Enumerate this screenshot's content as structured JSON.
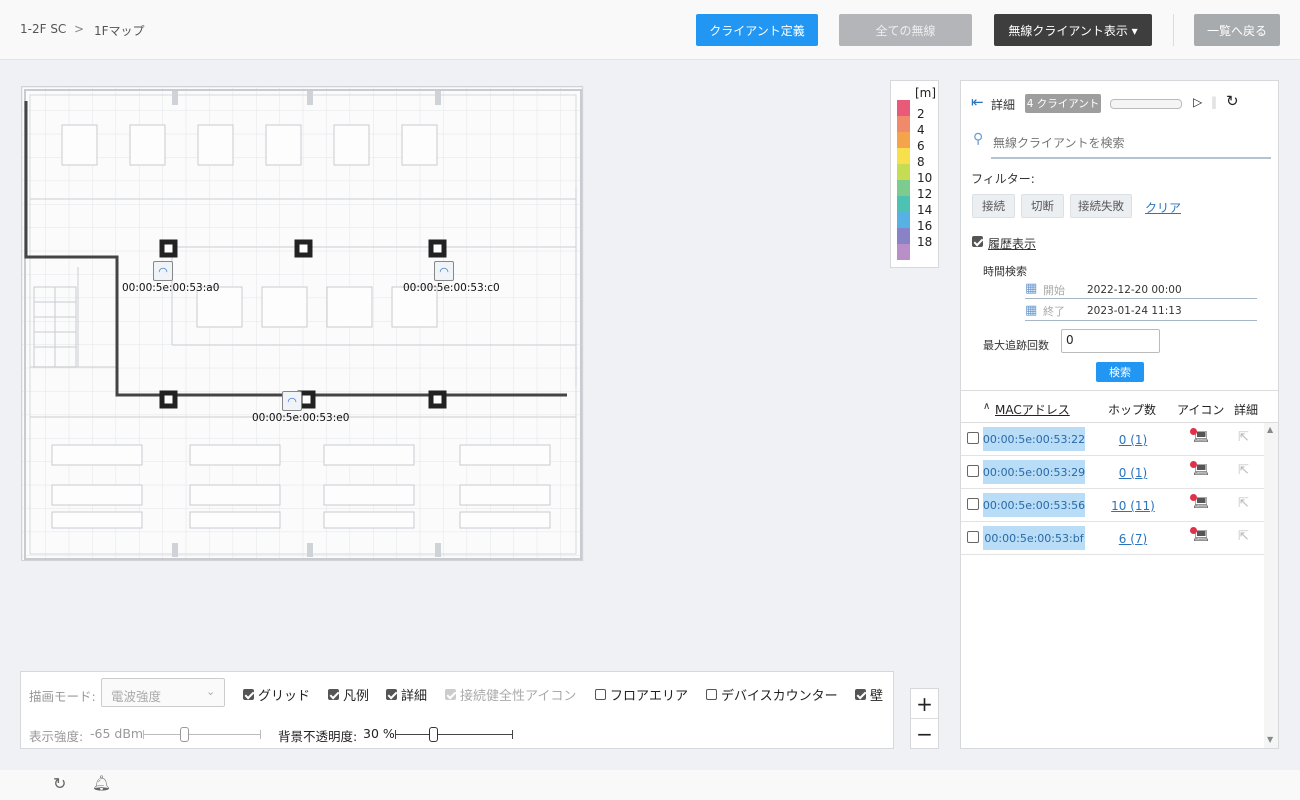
{
  "header": {
    "breadcrumb_site": "1-2F SC",
    "breadcrumb_sep": ">",
    "breadcrumb_map": "1Fマップ",
    "client_define_label": "クライアント定義",
    "all_wireless_label": "全ての無線",
    "wireless_client_display_label": "無線クライアント表示 ▾",
    "back_to_list_label": "一覧へ戻る"
  },
  "map": {
    "access_points": [
      {
        "label": "00:00:5e:00:53:a0"
      },
      {
        "label": "00:00:5e:00:53:c0"
      },
      {
        "label": "00:00:5e:00:53:e0"
      }
    ]
  },
  "legend": {
    "unit": "[m]",
    "items": [
      {
        "value": "2",
        "color": "#e95a79"
      },
      {
        "value": "4",
        "color": "#f08a6a"
      },
      {
        "value": "6",
        "color": "#f5a44b"
      },
      {
        "value": "8",
        "color": "#f7e04c"
      },
      {
        "value": "10",
        "color": "#c6dc53"
      },
      {
        "value": "12",
        "color": "#7ecb8f"
      },
      {
        "value": "14",
        "color": "#4cc3b2"
      },
      {
        "value": "16",
        "color": "#58b1e3"
      },
      {
        "value": "18",
        "color": "#8a82c6"
      }
    ],
    "last_color": "#b98fc8"
  },
  "panel": {
    "detail_label": "詳細",
    "client_count_badge": "4 クライアント",
    "search_placeholder": "無線クライアントを検索",
    "filter_label": "フィルター:",
    "filter_connected": "接続",
    "filter_disconnected": "切断",
    "filter_failed": "接続失敗",
    "filter_clear": "クリア",
    "history_label": "履歴表示",
    "time_search_label": "時間検索",
    "start_label": "開始",
    "start_value": "2022-12-20 00:00",
    "end_label": "終了",
    "end_value": "2023-01-24 11:13",
    "max_track_label": "最大追跡回数",
    "max_track_value": "0",
    "search_button": "検索",
    "columns": {
      "mac": "MACアドレス",
      "hops": "ホップ数",
      "icon": "アイコン",
      "detail": "詳細"
    },
    "rows": [
      {
        "mac": "00:00:5e:00:53:22",
        "hops": "0 (1)"
      },
      {
        "mac": "00:00:5e:00:53:29",
        "hops": "0 (1)"
      },
      {
        "mac": "00:00:5e:00:53:56",
        "hops": "10 (11)"
      },
      {
        "mac": "00:00:5e:00:53:bf",
        "hops": "6 (7)"
      }
    ]
  },
  "bottom": {
    "draw_mode_label": "描画モード:",
    "draw_mode_value": "電波強度",
    "grid_label": "グリッド",
    "legend_label": "凡例",
    "detail_label": "詳細",
    "health_icon_label": "接続健全性アイコン",
    "floor_area_label": "フロアエリア",
    "device_counter_label": "デバイスカウンター",
    "wall_label": "壁",
    "display_strength_label": "表示強度:",
    "display_strength_value": "-65 dBm",
    "bg_opacity_label": "背景不透明度:",
    "bg_opacity_value": "30 %",
    "zoom_in": "+",
    "zoom_out": "−"
  }
}
